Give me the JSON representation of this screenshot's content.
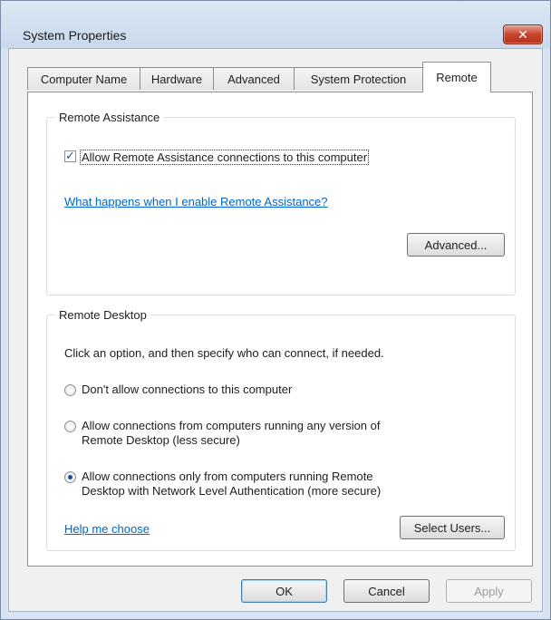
{
  "window": {
    "title": "System Properties",
    "close_symbol": "✕"
  },
  "tabs": [
    {
      "label": "Computer Name"
    },
    {
      "label": "Hardware"
    },
    {
      "label": "Advanced"
    },
    {
      "label": "System Protection"
    },
    {
      "label": "Remote",
      "active": true
    }
  ],
  "remote_assistance": {
    "group_label": "Remote Assistance",
    "allow_checkbox_label": "Allow Remote Assistance connections to this computer",
    "allow_checked": true,
    "help_link": "What happens when I enable Remote Assistance?",
    "advanced_button": "Advanced..."
  },
  "remote_desktop": {
    "group_label": "Remote Desktop",
    "instruction": "Click an option, and then specify who can connect, if needed.",
    "options": [
      {
        "line1": "Don't allow connections to this computer",
        "line2": "",
        "selected": false
      },
      {
        "line1": "Allow connections from computers running any version of",
        "line2": "Remote Desktop (less secure)",
        "selected": false
      },
      {
        "line1": "Allow connections only from computers running Remote",
        "line2": "Desktop with Network Level Authentication (more secure)",
        "selected": true
      }
    ],
    "help_link": "Help me choose",
    "select_users_button": "Select Users..."
  },
  "footer": {
    "ok": "OK",
    "cancel": "Cancel",
    "apply": "Apply"
  }
}
